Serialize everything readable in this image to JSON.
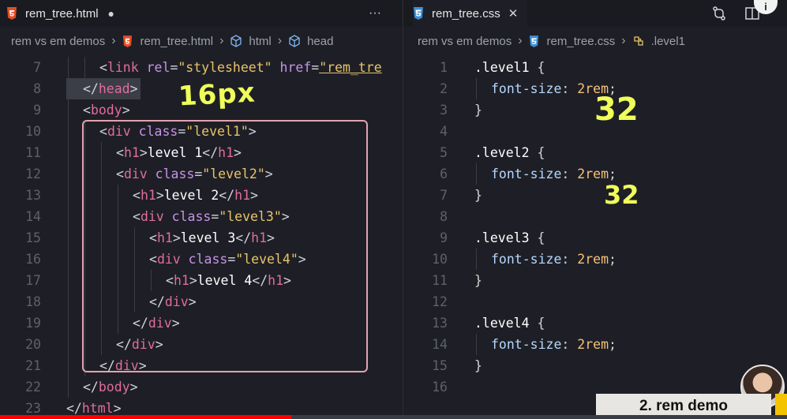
{
  "left_editor": {
    "tab": {
      "icon": "html5-icon",
      "filename": "rem_tree.html",
      "dirty_indicator": "●",
      "more_label": "···"
    },
    "breadcrumbs": [
      "rem vs em demos",
      "rem_tree.html",
      "html",
      "head"
    ],
    "lines": [
      {
        "n": "7",
        "indent": 2,
        "tokens": [
          [
            "br",
            "<"
          ],
          [
            "tag",
            "link"
          ],
          [
            "attr",
            " rel"
          ],
          [
            "br",
            "="
          ],
          [
            "str",
            "\"stylesheet\""
          ],
          [
            "attr",
            " href"
          ],
          [
            "br",
            "="
          ],
          [
            "str-u",
            "\"rem_tre"
          ]
        ]
      },
      {
        "n": "8",
        "indent": 1,
        "tokens": [
          [
            "br",
            "</"
          ],
          [
            "tag",
            "head"
          ],
          [
            "br",
            ">"
          ]
        ]
      },
      {
        "n": "9",
        "indent": 1,
        "tokens": [
          [
            "br",
            "<"
          ],
          [
            "tag",
            "body"
          ],
          [
            "br",
            ">"
          ]
        ]
      },
      {
        "n": "10",
        "indent": 2,
        "tokens": [
          [
            "br",
            "<"
          ],
          [
            "tag",
            "div"
          ],
          [
            "attr",
            " class"
          ],
          [
            "br",
            "="
          ],
          [
            "str",
            "\"level1\""
          ],
          [
            "br",
            ">"
          ]
        ]
      },
      {
        "n": "11",
        "indent": 3,
        "tokens": [
          [
            "br",
            "<"
          ],
          [
            "tag",
            "h1"
          ],
          [
            "br",
            ">"
          ],
          [
            "txt",
            "level 1"
          ],
          [
            "br",
            "</"
          ],
          [
            "tag",
            "h1"
          ],
          [
            "br",
            ">"
          ]
        ]
      },
      {
        "n": "12",
        "indent": 3,
        "tokens": [
          [
            "br",
            "<"
          ],
          [
            "tag",
            "div"
          ],
          [
            "attr",
            " class"
          ],
          [
            "br",
            "="
          ],
          [
            "str",
            "\"level2\""
          ],
          [
            "br",
            ">"
          ]
        ]
      },
      {
        "n": "13",
        "indent": 4,
        "tokens": [
          [
            "br",
            "<"
          ],
          [
            "tag",
            "h1"
          ],
          [
            "br",
            ">"
          ],
          [
            "txt",
            "level 2"
          ],
          [
            "br",
            "</"
          ],
          [
            "tag",
            "h1"
          ],
          [
            "br",
            ">"
          ]
        ]
      },
      {
        "n": "14",
        "indent": 4,
        "tokens": [
          [
            "br",
            "<"
          ],
          [
            "tag",
            "div"
          ],
          [
            "attr",
            " class"
          ],
          [
            "br",
            "="
          ],
          [
            "str",
            "\"level3\""
          ],
          [
            "br",
            ">"
          ]
        ]
      },
      {
        "n": "15",
        "indent": 5,
        "tokens": [
          [
            "br",
            "<"
          ],
          [
            "tag",
            "h1"
          ],
          [
            "br",
            ">"
          ],
          [
            "txt",
            "level 3"
          ],
          [
            "br",
            "</"
          ],
          [
            "tag",
            "h1"
          ],
          [
            "br",
            ">"
          ]
        ]
      },
      {
        "n": "16",
        "indent": 5,
        "tokens": [
          [
            "br",
            "<"
          ],
          [
            "tag",
            "div"
          ],
          [
            "attr",
            " class"
          ],
          [
            "br",
            "="
          ],
          [
            "str",
            "\"level4\""
          ],
          [
            "br",
            ">"
          ]
        ]
      },
      {
        "n": "17",
        "indent": 6,
        "tokens": [
          [
            "br",
            "<"
          ],
          [
            "tag",
            "h1"
          ],
          [
            "br",
            ">"
          ],
          [
            "txt",
            "level 4"
          ],
          [
            "br",
            "</"
          ],
          [
            "tag",
            "h1"
          ],
          [
            "br",
            ">"
          ]
        ]
      },
      {
        "n": "18",
        "indent": 5,
        "tokens": [
          [
            "br",
            "</"
          ],
          [
            "tag",
            "div"
          ],
          [
            "br",
            ">"
          ]
        ]
      },
      {
        "n": "19",
        "indent": 4,
        "tokens": [
          [
            "br",
            "</"
          ],
          [
            "tag",
            "div"
          ],
          [
            "br",
            ">"
          ]
        ]
      },
      {
        "n": "20",
        "indent": 3,
        "tokens": [
          [
            "br",
            "</"
          ],
          [
            "tag",
            "div"
          ],
          [
            "br",
            ">"
          ]
        ]
      },
      {
        "n": "21",
        "indent": 2,
        "tokens": [
          [
            "br",
            "</"
          ],
          [
            "tag",
            "div"
          ],
          [
            "br",
            ">"
          ]
        ]
      },
      {
        "n": "22",
        "indent": 1,
        "tokens": [
          [
            "br",
            "</"
          ],
          [
            "tag",
            "body"
          ],
          [
            "br",
            ">"
          ]
        ]
      },
      {
        "n": "23",
        "indent": 0,
        "tokens": [
          [
            "br",
            "</"
          ],
          [
            "tag",
            "html"
          ],
          [
            "br",
            ">"
          ]
        ]
      }
    ],
    "annotation": "16px"
  },
  "right_editor": {
    "tab": {
      "icon": "css3-icon",
      "filename": "rem_tree.css",
      "close_label": "✕"
    },
    "breadcrumbs": [
      "rem vs em demos",
      "rem_tree.css",
      ".level1"
    ],
    "lines": [
      {
        "n": "1",
        "indent": 0,
        "tokens": [
          [
            "sel",
            ".level1"
          ],
          [
            "pun",
            " {"
          ]
        ]
      },
      {
        "n": "2",
        "indent": 1,
        "tokens": [
          [
            "prop",
            "font-size"
          ],
          [
            "pun",
            ": "
          ],
          [
            "num",
            "2rem"
          ],
          [
            "pun",
            ";"
          ]
        ]
      },
      {
        "n": "3",
        "indent": 0,
        "tokens": [
          [
            "pun",
            "}"
          ]
        ]
      },
      {
        "n": "4",
        "indent": 0,
        "tokens": []
      },
      {
        "n": "5",
        "indent": 0,
        "tokens": [
          [
            "sel",
            ".level2"
          ],
          [
            "pun",
            " {"
          ]
        ]
      },
      {
        "n": "6",
        "indent": 1,
        "tokens": [
          [
            "prop",
            "font-size"
          ],
          [
            "pun",
            ": "
          ],
          [
            "num",
            "2rem"
          ],
          [
            "pun",
            ";"
          ]
        ]
      },
      {
        "n": "7",
        "indent": 0,
        "tokens": [
          [
            "pun",
            "}"
          ]
        ]
      },
      {
        "n": "8",
        "indent": 0,
        "tokens": []
      },
      {
        "n": "9",
        "indent": 0,
        "tokens": [
          [
            "sel",
            ".level3"
          ],
          [
            "pun",
            " {"
          ]
        ]
      },
      {
        "n": "10",
        "indent": 1,
        "tokens": [
          [
            "prop",
            "font-size"
          ],
          [
            "pun",
            ": "
          ],
          [
            "num",
            "2rem"
          ],
          [
            "pun",
            ";"
          ]
        ]
      },
      {
        "n": "11",
        "indent": 0,
        "tokens": [
          [
            "pun",
            "}"
          ]
        ]
      },
      {
        "n": "12",
        "indent": 0,
        "tokens": []
      },
      {
        "n": "13",
        "indent": 0,
        "tokens": [
          [
            "sel",
            ".level4"
          ],
          [
            "pun",
            " {"
          ]
        ]
      },
      {
        "n": "14",
        "indent": 1,
        "tokens": [
          [
            "prop",
            "font-size"
          ],
          [
            "pun",
            ": "
          ],
          [
            "num",
            "2rem"
          ],
          [
            "pun",
            ";"
          ]
        ]
      },
      {
        "n": "15",
        "indent": 0,
        "tokens": [
          [
            "pun",
            "}"
          ]
        ]
      },
      {
        "n": "16",
        "indent": 0,
        "tokens": []
      }
    ],
    "annotations": [
      "32",
      "32"
    ]
  },
  "video": {
    "caption": "2. rem demo",
    "info_label": "i",
    "progress_percent": 37
  },
  "colors": {
    "annotation": "#f0ff5a",
    "selection_box": "#e3a2ae",
    "progress": "#ff0000"
  }
}
